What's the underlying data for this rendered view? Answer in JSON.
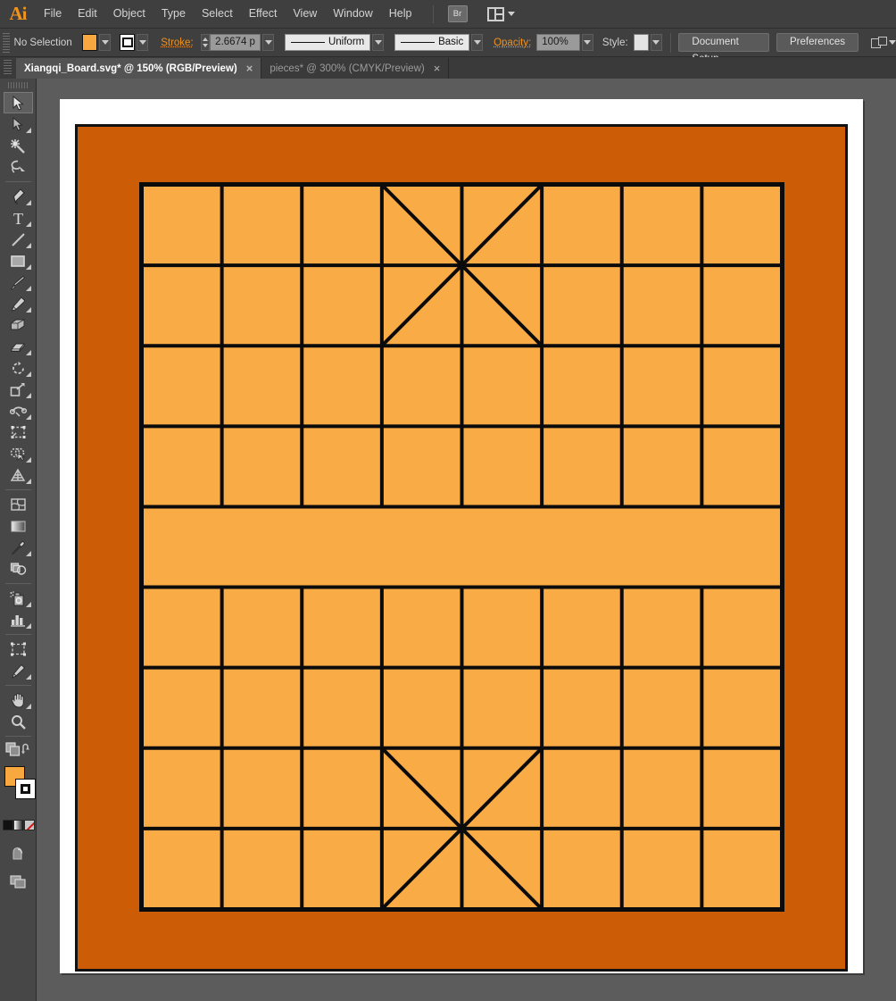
{
  "app": {
    "name": "Ai",
    "menu": [
      "File",
      "Edit",
      "Object",
      "Type",
      "Select",
      "Effect",
      "View",
      "Window",
      "Help"
    ],
    "bridge_label": "Br",
    "arrange_icon": "arrange-documents-icon"
  },
  "control_bar": {
    "selection_status": "No Selection",
    "fill_color": "#f7a83f",
    "stroke_color": "#000000",
    "stroke_label": "Stroke:",
    "stroke_weight": "2.6674 p",
    "variable_width_profile": "Uniform",
    "brush_definition": "Basic",
    "opacity_label": "Opacity:",
    "opacity_value": "100%",
    "style_label": "Style:",
    "style_color": "#e3e3e3",
    "document_setup_label": "Document Setup",
    "preferences_label": "Preferences"
  },
  "tabs": [
    {
      "label": "Xiangqi_Board.svg* @ 150% (RGB/Preview)",
      "active": true,
      "close": "×"
    },
    {
      "label": "pieces* @ 300% (CMYK/Preview)",
      "active": false,
      "close": "×"
    }
  ],
  "toolbar": {
    "tools": [
      {
        "name": "selection-tool",
        "selected": true,
        "has_flyout": false
      },
      {
        "name": "direct-selection-tool",
        "selected": false,
        "has_flyout": true
      },
      {
        "name": "magic-wand-tool",
        "selected": false,
        "has_flyout": false
      },
      {
        "name": "lasso-tool",
        "selected": false,
        "has_flyout": false
      },
      {
        "name": "pen-tool",
        "selected": false,
        "has_flyout": true
      },
      {
        "name": "type-tool",
        "selected": false,
        "has_flyout": true
      },
      {
        "name": "line-segment-tool",
        "selected": false,
        "has_flyout": true
      },
      {
        "name": "rectangle-tool",
        "selected": false,
        "has_flyout": true
      },
      {
        "name": "paintbrush-tool",
        "selected": false,
        "has_flyout": true
      },
      {
        "name": "pencil-tool",
        "selected": false,
        "has_flyout": true
      },
      {
        "name": "blob-brush-tool",
        "selected": false,
        "has_flyout": false
      },
      {
        "name": "eraser-tool",
        "selected": false,
        "has_flyout": true
      },
      {
        "name": "rotate-tool",
        "selected": false,
        "has_flyout": true
      },
      {
        "name": "scale-tool",
        "selected": false,
        "has_flyout": true
      },
      {
        "name": "width-warp-tool",
        "selected": false,
        "has_flyout": true
      },
      {
        "name": "free-transform-tool",
        "selected": false,
        "has_flyout": false
      },
      {
        "name": "shape-builder-tool",
        "selected": false,
        "has_flyout": true
      },
      {
        "name": "perspective-grid-tool",
        "selected": false,
        "has_flyout": true
      },
      {
        "name": "mesh-tool",
        "selected": false,
        "has_flyout": false
      },
      {
        "name": "gradient-tool",
        "selected": false,
        "has_flyout": false
      },
      {
        "name": "eyedropper-tool",
        "selected": false,
        "has_flyout": true
      },
      {
        "name": "blend-tool",
        "selected": false,
        "has_flyout": false
      },
      {
        "name": "symbol-sprayer-tool",
        "selected": false,
        "has_flyout": true
      },
      {
        "name": "column-graph-tool",
        "selected": false,
        "has_flyout": true
      },
      {
        "name": "artboard-tool",
        "selected": false,
        "has_flyout": false
      },
      {
        "name": "slice-tool",
        "selected": false,
        "has_flyout": true
      },
      {
        "name": "hand-tool",
        "selected": false,
        "has_flyout": true
      },
      {
        "name": "zoom-tool",
        "selected": false,
        "has_flyout": false
      }
    ],
    "fill_color": "#f7a83f",
    "stroke_color": "#000000",
    "swap_icon": "swap-fill-stroke-icon",
    "color_modes": [
      "color-swatch-mode",
      "gradient-mode",
      "none-mode"
    ],
    "drawing_mode_icon": "draw-normal-icon",
    "screen_mode_icon": "change-screen-mode-icon"
  },
  "artwork": {
    "title": "Xiangqi_Board",
    "background_color": "#cc5c05",
    "board_color": "#f9ab46",
    "line_color": "#0b0b0b",
    "selection_color": "#3a54e8",
    "columns": 8,
    "rows": 9,
    "river_row_index": 4,
    "palaces": [
      {
        "name": "top-palace",
        "col_start": 3,
        "col_span": 2,
        "row_start": 0,
        "row_span": 2
      },
      {
        "name": "bottom-palace",
        "col_start": 3,
        "col_span": 2,
        "row_start": 7,
        "row_span": 2
      }
    ],
    "grid_line_width": 4,
    "board_border_width": 3
  }
}
